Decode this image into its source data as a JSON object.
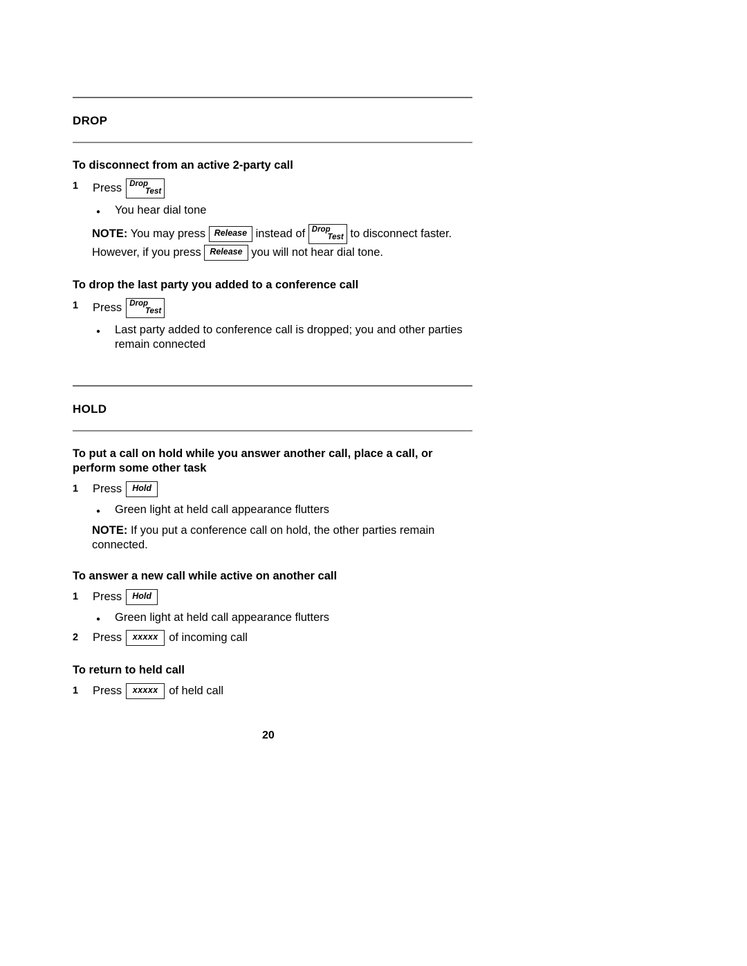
{
  "page": {
    "number": "20"
  },
  "keys": {
    "drop_test": {
      "top": "Drop",
      "bottom": "Test"
    },
    "release": "Release",
    "hold": "Hold",
    "xxxxx": "xxxxx"
  },
  "sections": [
    {
      "id": "drop",
      "title": "DROP",
      "procedures": [
        {
          "id": "disconnect-2party",
          "heading": "To disconnect from an active 2-party call",
          "steps": [
            {
              "num": "1",
              "press_label": "Press",
              "key": "drop_test",
              "suffix": ""
            }
          ],
          "bullets": [
            "You hear dial tone"
          ],
          "note": {
            "label": "NOTE:",
            "part1": "You may press",
            "part2": "instead of",
            "part3": "to disconnect faster.  However, if you press",
            "part4": "you will not hear dial tone."
          }
        },
        {
          "id": "drop-last-party",
          "heading": "To drop the last party you added to a conference call",
          "steps": [
            {
              "num": "1",
              "press_label": "Press",
              "key": "drop_test",
              "suffix": ""
            }
          ],
          "bullets": [
            "Last party added to conference call is dropped; you and other parties remain connected"
          ]
        }
      ]
    },
    {
      "id": "hold",
      "title": "HOLD",
      "procedures": [
        {
          "id": "put-call-on-hold",
          "heading": "To put a call on hold while you answer another call, place a call, or perform some other task",
          "steps": [
            {
              "num": "1",
              "press_label": "Press",
              "key": "hold",
              "suffix": ""
            }
          ],
          "bullets": [
            "Green light at held call appearance flutters"
          ],
          "note": {
            "label": "NOTE:",
            "text": "If you put a conference call on hold, the other parties remain connected."
          }
        },
        {
          "id": "answer-new-call",
          "heading": "To answer a new call while active on another call",
          "steps": [
            {
              "num": "1",
              "press_label": "Press",
              "key": "hold",
              "suffix": ""
            },
            {
              "num": "2",
              "press_label": "Press",
              "key": "xxxxx",
              "suffix": "of incoming call"
            }
          ],
          "bullets": [
            "Green light at held call appearance flutters"
          ]
        },
        {
          "id": "return-to-held-call",
          "heading": "To return to held call",
          "steps": [
            {
              "num": "1",
              "press_label": "Press",
              "key": "xxxxx",
              "suffix": "of held call"
            }
          ]
        }
      ]
    }
  ]
}
